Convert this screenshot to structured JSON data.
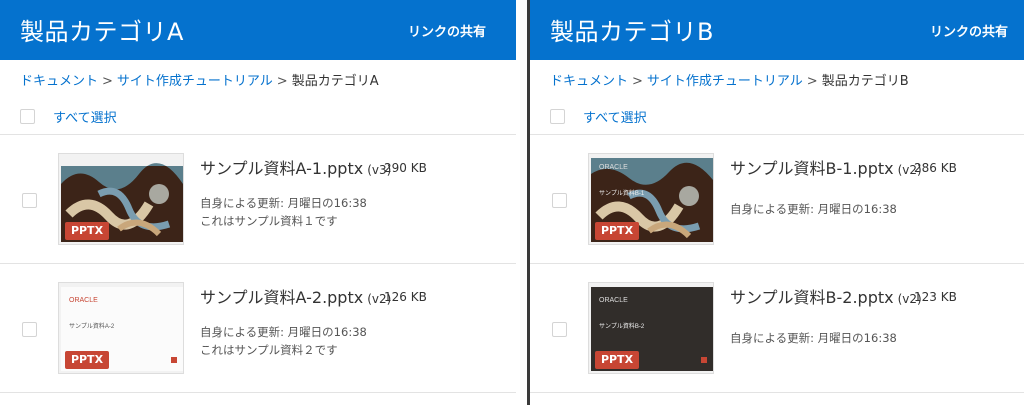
{
  "panels": [
    {
      "title": "製品カテゴリA",
      "share_label": "リンクの共有",
      "breadcrumb": [
        "ドキュメント",
        "サイト作成チュートリアル",
        "製品カテゴリA"
      ],
      "separator": ">",
      "select_all_label": "すべて選択",
      "files": [
        {
          "name": "サンプル資料A-1.pptx",
          "version": "(v3)",
          "size": "290 KB",
          "updated": "自身による更新: 月曜日の16:38",
          "description": "これはサンプル資料１です",
          "badge": "PPTX",
          "thumb_style": "art"
        },
        {
          "name": "サンプル資料A-2.pptx",
          "version": "(v2)",
          "size": "126 KB",
          "updated": "自身による更新: 月曜日の16:38",
          "description": "これはサンプル資料２です",
          "badge": "PPTX",
          "thumb_style": "light",
          "thumb_brand": "ORACLE",
          "thumb_caption": "サンプル資料A-2"
        }
      ]
    },
    {
      "title": "製品カテゴリB",
      "share_label": "リンクの共有",
      "breadcrumb": [
        "ドキュメント",
        "サイト作成チュートリアル",
        "製品カテゴリB"
      ],
      "separator": ">",
      "select_all_label": "すべて選択",
      "files": [
        {
          "name": "サンプル資料B-1.pptx",
          "version": "(v2)",
          "size": "286 KB",
          "updated": "自身による更新: 月曜日の16:38",
          "badge": "PPTX",
          "thumb_style": "art",
          "thumb_brand": "ORACLE",
          "thumb_caption": "サンプル資料B-1"
        },
        {
          "name": "サンプル資料B-2.pptx",
          "version": "(v2)",
          "size": "123 KB",
          "updated": "自身による更新: 月曜日の16:38",
          "badge": "PPTX",
          "thumb_style": "dark",
          "thumb_brand": "ORACLE",
          "thumb_caption": "サンプル資料B-2"
        }
      ]
    }
  ],
  "colors": {
    "header": "#0572ce",
    "link": "#0572ce",
    "badge": "#c74634"
  }
}
